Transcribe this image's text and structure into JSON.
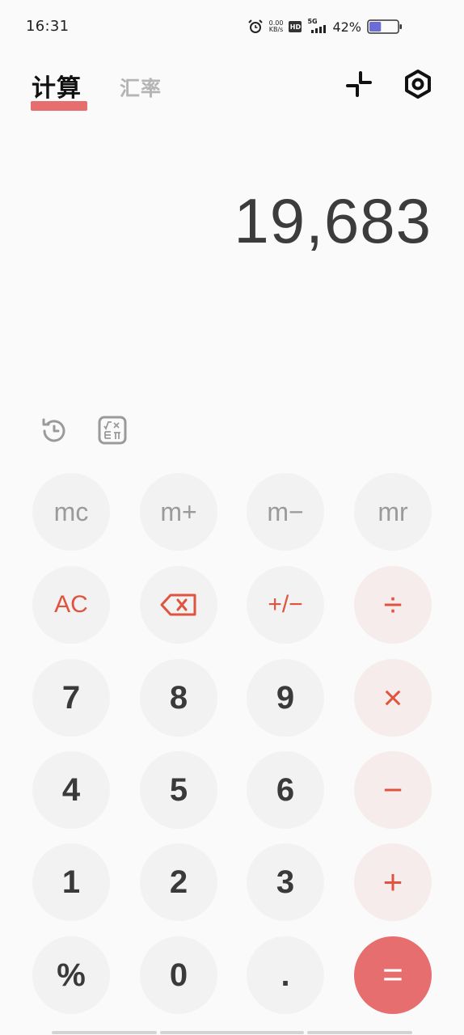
{
  "status": {
    "time": "16:31",
    "speed_value": "0.00",
    "speed_unit": "KB/s",
    "hd_label": "HD",
    "network": "5G",
    "battery_pct": "42%",
    "battery_level": 0.42
  },
  "tabs": {
    "calculator": "计算",
    "exchange": "汇率"
  },
  "display": {
    "value": "19,683"
  },
  "keys": {
    "mc": "mc",
    "mplus": "m+",
    "mminus": "m−",
    "mr": "mr",
    "ac": "AC",
    "sign": "+/−",
    "divide": "÷",
    "seven": "7",
    "eight": "8",
    "nine": "9",
    "multiply": "×",
    "four": "4",
    "five": "5",
    "six": "6",
    "minus": "−",
    "one": "1",
    "two": "2",
    "three": "3",
    "plus": "+",
    "percent": "%",
    "zero": "0",
    "dot": ".",
    "equals": "="
  },
  "colors": {
    "accent": "#e66e6f",
    "operator": "#e0533f",
    "key_bg": "#f2f2f2",
    "operator_bg": "#f7ecec"
  },
  "icons": {
    "alarm": "alarm-clock-icon",
    "shrink": "shrink-icon",
    "settings": "gear-icon",
    "history": "history-icon",
    "scientific": "scientific-icon",
    "backspace": "backspace-icon"
  }
}
